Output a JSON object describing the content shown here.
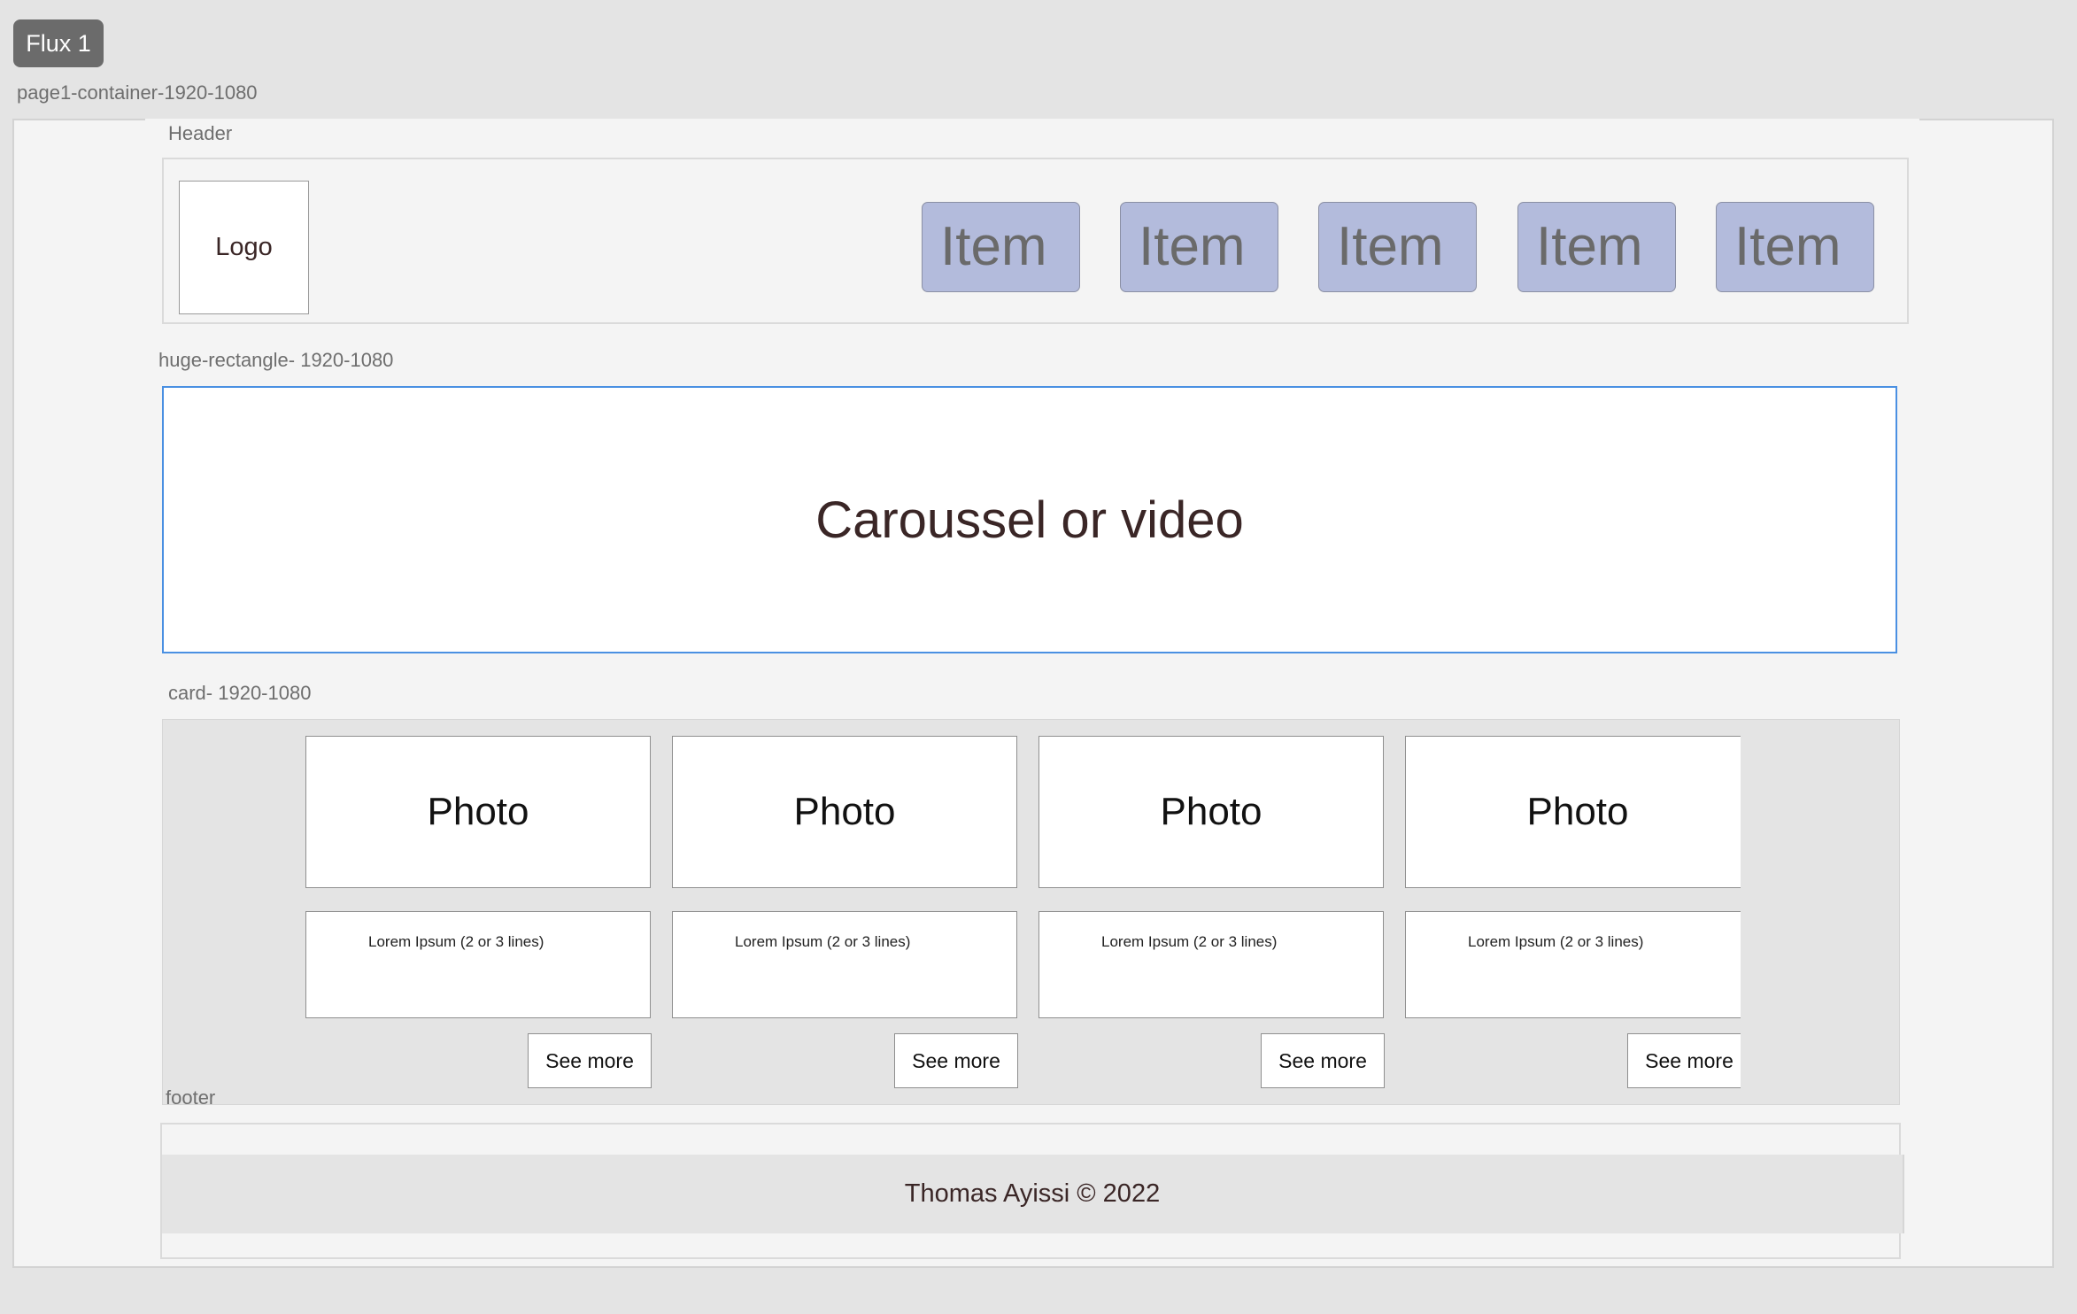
{
  "flow": {
    "badge": "Flux 1"
  },
  "frames": {
    "page": "page1-container-1920-1080",
    "header": "Header",
    "hero": "huge-rectangle- 1920-1080",
    "cards": "card- 1920-1080",
    "footer": "footer"
  },
  "header": {
    "logo": "Logo",
    "nav_items": [
      "Item",
      "Item",
      "Item",
      "Item",
      "Item"
    ],
    "nav_color": "#b3bbdc"
  },
  "hero": {
    "text": "Caroussel or video",
    "outline_color": "#4a90e2"
  },
  "cards": [
    {
      "photo": "Photo",
      "text": "Lorem Ipsum (2 or 3 lines)",
      "button": "See more"
    },
    {
      "photo": "Photo",
      "text": "Lorem Ipsum (2 or 3 lines)",
      "button": "See more"
    },
    {
      "photo": "Photo",
      "text": "Lorem Ipsum (2 or 3 lines)",
      "button": "See more"
    },
    {
      "photo": "Photo",
      "text": "Lorem Ipsum (2 or 3 lines)",
      "button": "See more"
    }
  ],
  "footer": {
    "text": "Thomas Ayissi © 2022"
  }
}
